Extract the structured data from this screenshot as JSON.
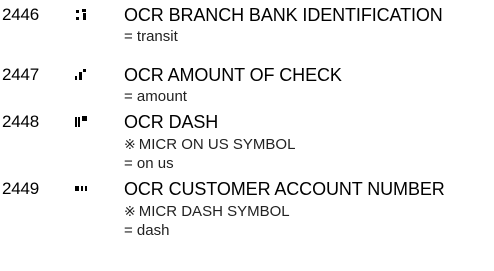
{
  "entries": [
    {
      "code": "2446",
      "glyph": "ocr-branch-bank-identification-glyph",
      "name": "OCR BRANCH BANK IDENTIFICATION",
      "notes": [
        {
          "mark": "",
          "text": "= transit"
        }
      ]
    },
    {
      "code": "2447",
      "glyph": "ocr-amount-of-check-glyph",
      "name": "OCR AMOUNT OF CHECK",
      "notes": [
        {
          "mark": "",
          "text": "= amount"
        }
      ]
    },
    {
      "code": "2448",
      "glyph": "ocr-dash-glyph",
      "name": "OCR DASH",
      "notes": [
        {
          "mark": "※",
          "text": "MICR ON US SYMBOL"
        },
        {
          "mark": "",
          "text": "= on us"
        }
      ]
    },
    {
      "code": "2449",
      "glyph": "ocr-customer-account-number-glyph",
      "name": "OCR CUSTOMER ACCOUNT NUMBER",
      "notes": [
        {
          "mark": "※",
          "text": "MICR DASH SYMBOL"
        },
        {
          "mark": "",
          "text": "= dash"
        }
      ]
    }
  ],
  "colors": {
    "text": "#000000",
    "note_text": "#222222",
    "background": "#ffffff"
  }
}
